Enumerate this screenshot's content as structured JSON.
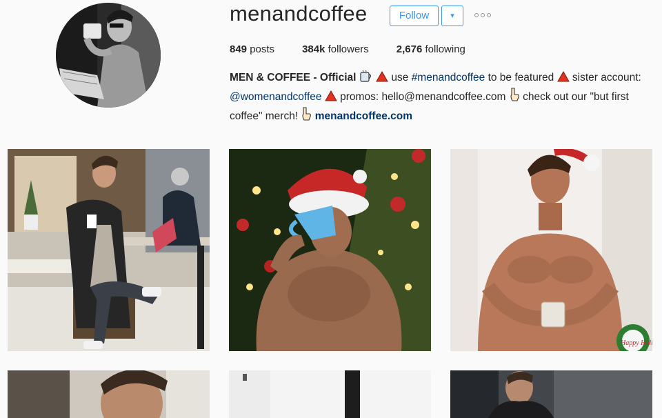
{
  "profile": {
    "username": "menandcoffee",
    "follow_label": "Follow",
    "dropdown_glyph": "▾",
    "stats": {
      "posts_count": "849",
      "posts_label": "posts",
      "followers_count": "384k",
      "followers_label": "followers",
      "following_count": "2,676",
      "following_label": "following"
    },
    "bio": {
      "name": "MEN & COFFEE - Official",
      "p1": "use",
      "hashtag": "#menandcoffee",
      "p2": "to be featured",
      "p3": "sister account:",
      "mention": "@womenandcoffee",
      "p4": "promos: hello@menandcoffee.com",
      "p5": "check out our \"but first coffee\" merch!",
      "link": "menandcoffee.com"
    }
  },
  "icons": {
    "coffee_cup": "coffee-emoji",
    "triangle": "red-triangle-emoji",
    "pointing_hand": "pointing-down-emoji",
    "more": "more-options-icon"
  },
  "colors": {
    "accent": "#3897f0",
    "link": "#003569",
    "background": "#fafafa",
    "triangle": "#e0321d"
  },
  "posts": [
    {
      "label": ""
    },
    {
      "label": ""
    },
    {
      "label": "Happy Holidays"
    },
    {
      "label": ""
    },
    {
      "label": ""
    },
    {
      "label": ""
    }
  ]
}
